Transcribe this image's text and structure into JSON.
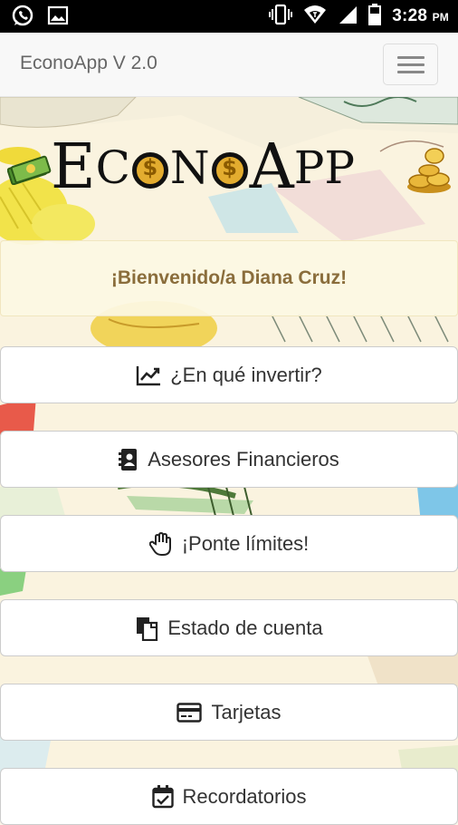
{
  "status_bar": {
    "time": "3:28",
    "time_suffix": "PM",
    "icons": [
      "whatsapp-icon",
      "image-icon",
      "vibrate-icon",
      "wifi-icon",
      "signal-icon",
      "battery-icon"
    ]
  },
  "navbar": {
    "brand": "EconoApp V 2.0",
    "toggle_icon": "hamburger-icon"
  },
  "logo": {
    "letters": [
      "E",
      "C",
      "O",
      "N",
      "O",
      "A",
      "P",
      "P"
    ]
  },
  "welcome": {
    "text": "¡Bienvenido/a Diana Cruz!"
  },
  "menu": [
    {
      "label": "¿En qué invertir?",
      "icon": "chart-line-icon"
    },
    {
      "label": "Asesores Financieros",
      "icon": "address-book-icon"
    },
    {
      "label": "¡Ponte límites!",
      "icon": "hand-stop-icon"
    },
    {
      "label": "Estado de cuenta",
      "icon": "copy-documents-icon"
    },
    {
      "label": "Tarjetas",
      "icon": "credit-card-icon"
    },
    {
      "label": "Recordatorios",
      "icon": "calendar-check-icon"
    }
  ],
  "colors": {
    "welcome_text": "#8a6d3b",
    "welcome_bg": "#fcf8e3",
    "navbar_bg": "#f8f8f8",
    "coin_gold": "#e3ac2f"
  }
}
